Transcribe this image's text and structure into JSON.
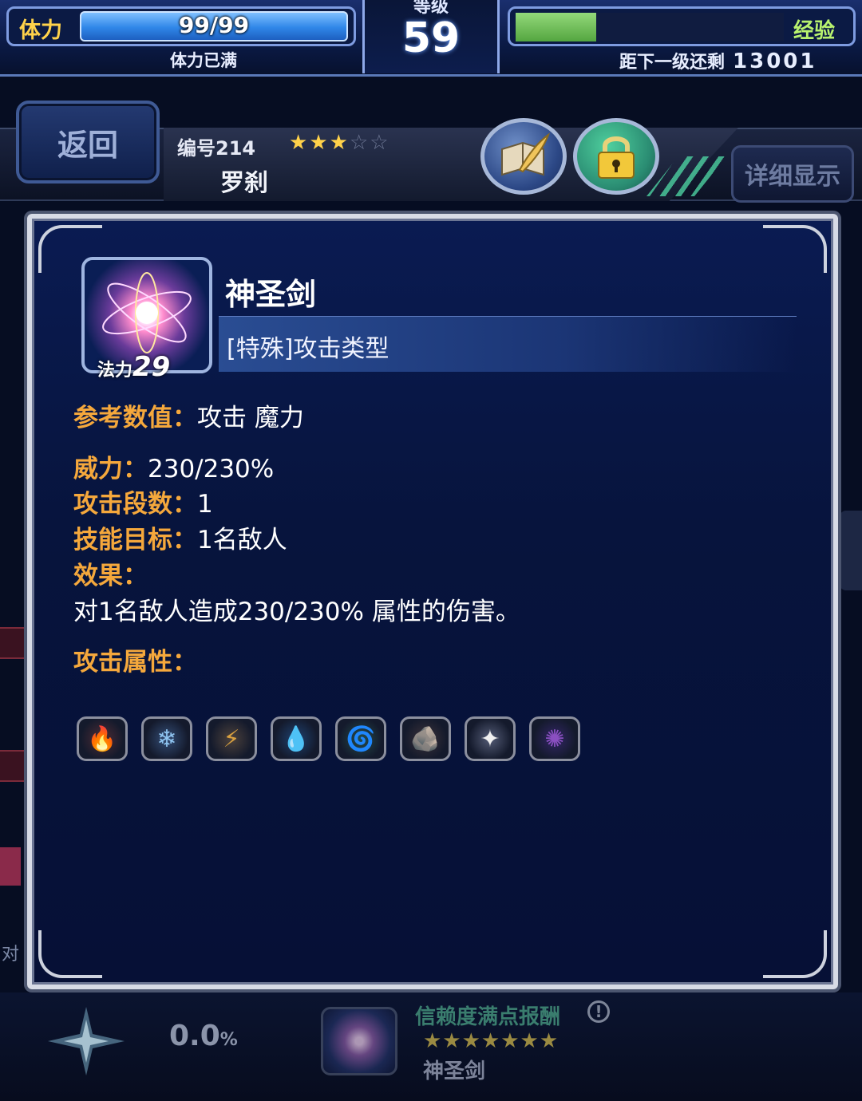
{
  "status": {
    "hp_label": "体力",
    "hp_value": "99/99",
    "hp_fraction": 1.0,
    "hp_status": "体力已满",
    "level_label": "等级",
    "level_value": "59",
    "exp_label": "经验",
    "exp_fraction": 0.3,
    "exp_remaining_label": "距下一级还剩",
    "exp_remaining_value": "13001"
  },
  "header": {
    "back_label": "返回",
    "unit_number": "编号214",
    "rarity_filled": 3,
    "rarity_total": 5,
    "unit_name": "罗刹",
    "detail_label": "详细显示"
  },
  "skill": {
    "name": "神圣剑",
    "type": "[特殊]攻击类型",
    "mp_label": "法力",
    "mp_cost": "29",
    "ref_key": "参考数值",
    "ref_value": "攻击 魔力",
    "power_key": "威力",
    "power_value": "230/230%",
    "hits_key": "攻击段数",
    "hits_value": "1",
    "target_key": "技能目标",
    "target_value": "1名敌人",
    "effect_key": "效果",
    "effect_text": "对1名敌人造成230/230% 属性的伤害。",
    "attr_key": "攻击属性",
    "elements": [
      {
        "name": "fire",
        "icon": "fire-icon",
        "color": "#e0602a",
        "glyph": "🔥"
      },
      {
        "name": "ice",
        "icon": "ice-icon",
        "color": "#8fc4f0",
        "glyph": "❄"
      },
      {
        "name": "lightning",
        "icon": "lightning-icon",
        "color": "#d8a040",
        "glyph": "⚡"
      },
      {
        "name": "water",
        "icon": "water-icon",
        "color": "#4fa3e0",
        "glyph": "💧"
      },
      {
        "name": "wind",
        "icon": "wind-icon",
        "color": "#5fbf6a",
        "glyph": "🌀"
      },
      {
        "name": "earth",
        "icon": "earth-icon",
        "color": "#a8743a",
        "glyph": "🪨"
      },
      {
        "name": "holy",
        "icon": "holy-icon",
        "color": "#f0f0f0",
        "glyph": "✦"
      },
      {
        "name": "dark",
        "icon": "dark-icon",
        "color": "#8a4fc0",
        "glyph": "✺"
      }
    ]
  },
  "trust": {
    "percent": "0.0",
    "percent_unit": "%",
    "reward_title": "信赖度满点报酬",
    "reward_stars": "★★★★★★★",
    "reward_name": "神圣剑"
  },
  "background": {
    "left_edge_text": "对"
  },
  "colors": {
    "accent_orange": "#f5a83c",
    "panel_blue": "#0a1b52",
    "hp_blue": "#2f86e8",
    "exp_green": "#54a640"
  }
}
